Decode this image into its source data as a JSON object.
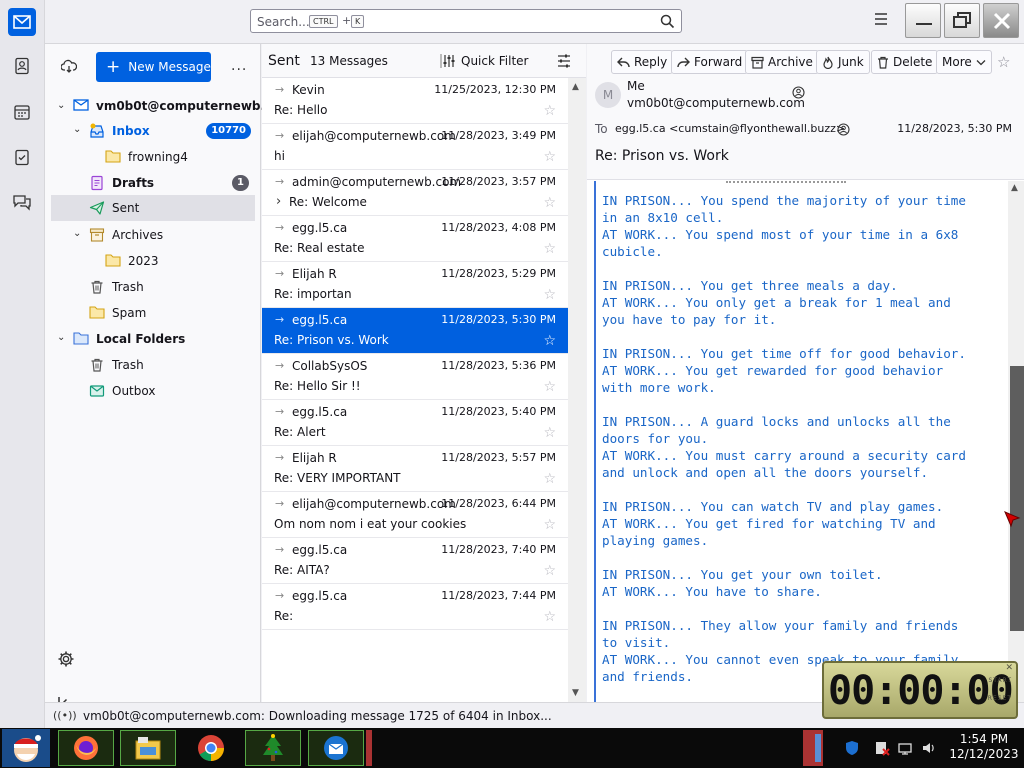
{
  "search": {
    "placeholder": "Search...",
    "key1": "CTRL",
    "plus": "+",
    "key2": "K"
  },
  "folderpane": {
    "new_message": "New Message",
    "more": "...",
    "account": "vm0b0t@computernewb...",
    "folders": [
      {
        "label": "Inbox",
        "badge": "10770"
      },
      {
        "label": "frowning4"
      },
      {
        "label": "Drafts",
        "badge": "1"
      },
      {
        "label": "Sent"
      },
      {
        "label": "Archives"
      },
      {
        "label": "2023"
      },
      {
        "label": "Trash"
      },
      {
        "label": "Spam"
      }
    ],
    "local": {
      "label": "Local Folders",
      "trash": "Trash",
      "outbox": "Outbox"
    }
  },
  "threadpane": {
    "folder": "Sent",
    "count": "13 Messages",
    "quick_filter": "Quick Filter",
    "rows": [
      {
        "correspondent": "Kevin",
        "date": "11/25/2023, 12:30 PM",
        "subject": "Re: Hello"
      },
      {
        "correspondent": "elijah@computernewb.com",
        "date": "11/28/2023, 3:49 PM",
        "subject": "hi"
      },
      {
        "correspondent": "admin@computernewb.com",
        "date": "11/28/2023, 3:57 PM",
        "subject": "Re: Welcome"
      },
      {
        "correspondent": "egg.l5.ca",
        "date": "11/28/2023, 4:08 PM",
        "subject": "Re: Real estate"
      },
      {
        "correspondent": "Elijah R",
        "date": "11/28/2023, 5:29 PM",
        "subject": "Re: importan"
      },
      {
        "correspondent": "egg.l5.ca",
        "date": "11/28/2023, 5:30 PM",
        "subject": "Re: Prison vs. Work"
      },
      {
        "correspondent": "CollabSysOS",
        "date": "11/28/2023, 5:36 PM",
        "subject": "Re: Hello Sir !!"
      },
      {
        "correspondent": "egg.l5.ca",
        "date": "11/28/2023, 5:40 PM",
        "subject": "Re: Alert"
      },
      {
        "correspondent": "Elijah R",
        "date": "11/28/2023, 5:57 PM",
        "subject": "Re: VERY IMPORTANT"
      },
      {
        "correspondent": "elijah@computernewb.com",
        "date": "11/28/2023, 6:44 PM",
        "subject": "Om nom nom i eat your cookies"
      },
      {
        "correspondent": "egg.l5.ca",
        "date": "11/28/2023, 7:40 PM",
        "subject": "Re: AITA?"
      },
      {
        "correspondent": "egg.l5.ca",
        "date": "11/28/2023, 7:44 PM",
        "subject": "Re:"
      }
    ]
  },
  "message": {
    "toolbar": {
      "reply": "Reply",
      "forward": "Forward",
      "archive": "Archive",
      "junk": "Junk",
      "delete": "Delete",
      "more": "More"
    },
    "avatar": "M",
    "from_name": "Me",
    "from_addr": "vm0b0t@computernewb.com",
    "to_label": "To",
    "to": "egg.l5.ca <cumstain@flyonthewall.buzz>",
    "date": "11/28/2023, 5:30 PM",
    "subject": "Re: Prison vs. Work",
    "body": "IN PRISON... You spend the majority of your time\nin an 8x10 cell.\nAT WORK... You spend most of your time in a 6x8\ncubicle.\n\nIN PRISON... You get three meals a day.\nAT WORK... You only get a break for 1 meal and\nyou have to pay for it.\n\nIN PRISON... You get time off for good behavior.\nAT WORK... You get rewarded for good behavior\nwith more work.\n\nIN PRISON... A guard locks and unlocks all the\ndoors for you.\nAT WORK... You must carry around a security card\nand unlock and open all the doors yourself.\n\nIN PRISON... You can watch TV and play games.\nAT WORK... You get fired for watching TV and\nplaying games.\n\nIN PRISON... You get your own toilet.\nAT WORK... You have to share.\n\nIN PRISON... They allow your family and friends\nto visit.\nAT WORK... You cannot even speak to your family\nand friends."
  },
  "status": {
    "text": "vm0b0t@computernewb.com: Downloading message 1725 of 6404 in Inbox..."
  },
  "clock": {
    "time": "00:00:00",
    "start": "START",
    "reset": "RESET"
  },
  "taskbar": {
    "time": "1:54 PM",
    "date": "12/12/2023"
  },
  "colors": {
    "accent": "#0061e0",
    "selected_row": "#0060df",
    "body_text": "#1a66c7"
  }
}
